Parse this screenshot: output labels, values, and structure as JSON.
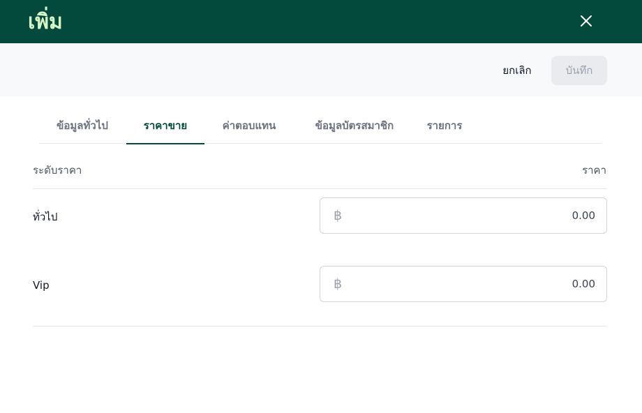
{
  "header": {
    "title": "เพิ่ม",
    "close_icon": "close-icon"
  },
  "actions": {
    "cancel_label": "ยกเลิก",
    "save_label": "บันทึก"
  },
  "tabs": [
    {
      "label": "ข้อมูลทั่วไป",
      "active": false
    },
    {
      "label": "ราคาขาย",
      "active": true
    },
    {
      "label": "ค่าตอบแทน",
      "active": false
    },
    {
      "label": "ข้อมูลบัตรสมาชิก",
      "active": false
    },
    {
      "label": "รายการ",
      "active": false
    }
  ],
  "price_table": {
    "col_level": "ระดับราคา",
    "col_price": "ราคา",
    "currency_symbol": "฿",
    "rows": [
      {
        "level": "ทั่วไป",
        "value": "0.00"
      },
      {
        "level": "Vip",
        "value": "0.00"
      }
    ]
  },
  "colors": {
    "header_bg": "#034a3c",
    "header_title": "#d6f5c6",
    "accent": "#034a3c"
  }
}
